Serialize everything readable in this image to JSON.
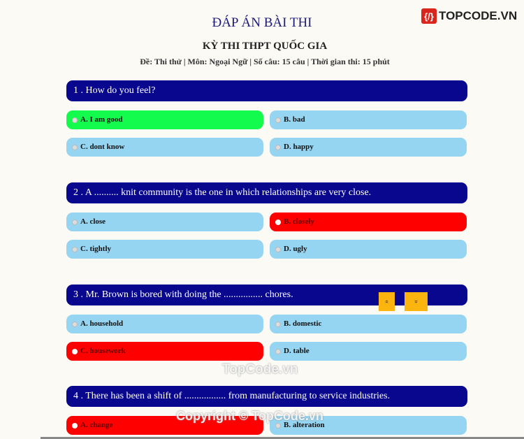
{
  "header": {
    "title": "ĐÁP ÁN BÀI THI",
    "logo": "TOPCODE.VN",
    "exam": "KỲ THI THPT QUỐC GIA",
    "meta": "Đề: Thi thử | Môn: Ngoại Ngữ | Số câu: 15 câu | Thời gian thi: 15 phút"
  },
  "colors": {
    "question_bg": "#08078e",
    "option_bg": "#96d5f2",
    "correct": "#13fb4c",
    "wrong": "#ff0000",
    "nav": "#fbb50e"
  },
  "questions": [
    {
      "text": "1 . How do you feel?",
      "options": [
        "A. I am good",
        "B. bad",
        "C. dont know",
        "D. happy"
      ],
      "states": [
        "correct",
        "",
        "",
        ""
      ]
    },
    {
      "text": "2 . A .......... knit community is the one in which relationships are very close.",
      "options": [
        "A. close",
        "B. closely",
        "C. tightly",
        "D. ugly"
      ],
      "states": [
        "",
        "wrong",
        "",
        ""
      ]
    },
    {
      "text": "3 . Mr. Brown is bored with doing the ................ chores.",
      "options": [
        "A. household",
        "B. domestic",
        "C. housework",
        "D. table"
      ],
      "states": [
        "",
        "",
        "wrong",
        ""
      ]
    },
    {
      "text": "4 . There has been a shift of ................. from manufacturing to service industries.",
      "options": [
        "A. change",
        "B. alteration"
      ],
      "states": [
        "wrong",
        ""
      ]
    }
  ],
  "nav": {
    "up": "«",
    "down": "»"
  },
  "watermarks": [
    "TopCode.vn",
    "Copyright © TopCode.vn"
  ]
}
